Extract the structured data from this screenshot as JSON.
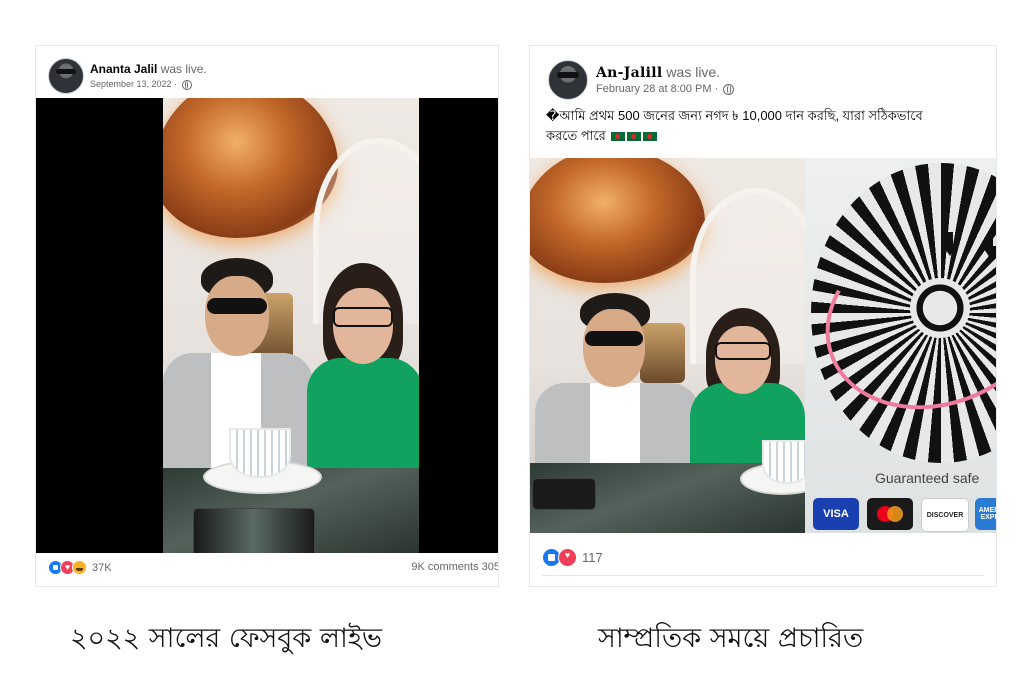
{
  "left_post": {
    "author": "Ananta Jalil",
    "status": "was live.",
    "date": "September 13, 2022 ·",
    "reaction_count": "37K",
    "comments": "9K comments  305"
  },
  "right_post": {
    "author": "An-Jalill",
    "status": "was live.",
    "date": "February 28 at 8:00 PM ·",
    "caption_line1": "�আমি প্রথম 500 জনের জন্য নগদ ৳ 10,000 দান করছি, যারা সঠিকভাবে",
    "caption_line2": "করতে পারে",
    "reaction_count": "117",
    "ad_text": "Guaranteed safe",
    "card_labels": {
      "visa": "VISA",
      "discover": "DISCOVER",
      "amex": "AMERI EXPR"
    }
  },
  "captions": {
    "left": "২০২২ সালের ফেসবুক লাইভ",
    "right": "সাম্প্রতিক সময়ে প্রচারিত"
  },
  "icons": {
    "privacy": "globe-icon",
    "reactions": [
      "like-icon",
      "love-icon",
      "haha-icon"
    ],
    "flag": "bangladesh-flag-icon"
  },
  "colors": {
    "facebook_blue": "#1877f2",
    "love_red": "#f33e58",
    "meta_gray": "#65676b",
    "dress_green": "#11a25f"
  }
}
